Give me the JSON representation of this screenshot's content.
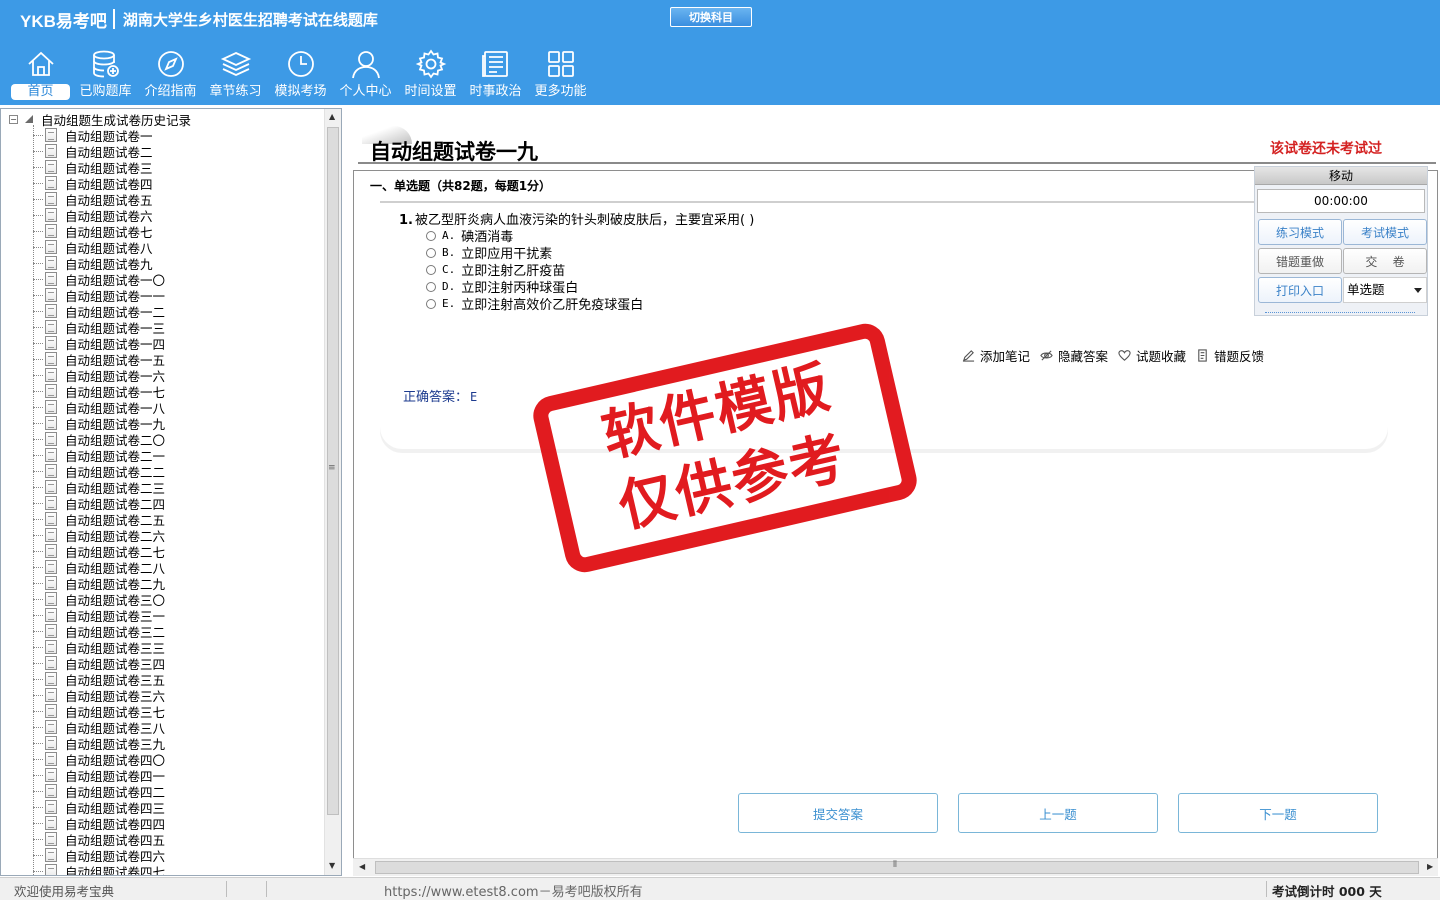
{
  "header": {
    "logo": "YKB易考吧",
    "app_title": "湖南大学生乡村医生招聘考试在线题库",
    "switch_subject": "切换科目",
    "nav": [
      {
        "label": "首页",
        "icon": "home-icon"
      },
      {
        "label": "已购题库",
        "icon": "database-icon"
      },
      {
        "label": "介绍指南",
        "icon": "compass-icon"
      },
      {
        "label": "章节练习",
        "icon": "layers-icon"
      },
      {
        "label": "模拟考场",
        "icon": "clock-icon"
      },
      {
        "label": "个人中心",
        "icon": "user-icon"
      },
      {
        "label": "时间设置",
        "icon": "gear-icon"
      },
      {
        "label": "时事政治",
        "icon": "news-icon"
      },
      {
        "label": "更多功能",
        "icon": "grid-icon"
      }
    ]
  },
  "tree": {
    "root": "自动组题生成试卷历史记录",
    "items": [
      "自动组题试卷一",
      "自动组题试卷二",
      "自动组题试卷三",
      "自动组题试卷四",
      "自动组题试卷五",
      "自动组题试卷六",
      "自动组题试卷七",
      "自动组题试卷八",
      "自动组题试卷九",
      "自动组题试卷一〇",
      "自动组题试卷一一",
      "自动组题试卷一二",
      "自动组题试卷一三",
      "自动组题试卷一四",
      "自动组题试卷一五",
      "自动组题试卷一六",
      "自动组题试卷一七",
      "自动组题试卷一八",
      "自动组题试卷一九",
      "自动组题试卷二〇",
      "自动组题试卷二一",
      "自动组题试卷二二",
      "自动组题试卷二三",
      "自动组题试卷二四",
      "自动组题试卷二五",
      "自动组题试卷二六",
      "自动组题试卷二七",
      "自动组题试卷二八",
      "自动组题试卷二九",
      "自动组题试卷三〇",
      "自动组题试卷三一",
      "自动组题试卷三二",
      "自动组题试卷三三",
      "自动组题试卷三四",
      "自动组题试卷三五",
      "自动组题试卷三六",
      "自动组题试卷三七",
      "自动组题试卷三八",
      "自动组题试卷三九",
      "自动组题试卷四〇",
      "自动组题试卷四一",
      "自动组题试卷四二",
      "自动组题试卷四三",
      "自动组题试卷四四",
      "自动组题试卷四五",
      "自动组题试卷四六",
      "自动组题试卷四七"
    ]
  },
  "main": {
    "paper_title": "自动组题试卷一九",
    "exam_status": "该试卷还未考试过",
    "section": "一、单选题（共82题，每题1分）",
    "question": {
      "number": "1.",
      "text": "被乙型肝炎病人血液污染的针头刺破皮肤后，主要宜采用( )",
      "options": [
        {
          "letter": "A.",
          "text": "碘酒消毒"
        },
        {
          "letter": "B.",
          "text": "立即应用干扰素"
        },
        {
          "letter": "C.",
          "text": "立即注射乙肝疫苗"
        },
        {
          "letter": "D.",
          "text": "立即注射丙种球蛋白"
        },
        {
          "letter": "E.",
          "text": "立即注射高效价乙肝免疫球蛋白"
        }
      ]
    },
    "actions": {
      "note": "添加笔记",
      "hide_answer": "隐藏答案",
      "favorite": "试题收藏",
      "feedback": "错题反馈"
    },
    "answer_label": "正确答案：",
    "answer_value": "E",
    "buttons": {
      "submit": "提交答案",
      "prev": "上一题",
      "next": "下一题"
    }
  },
  "control_panel": {
    "title": "移动",
    "timer": "00:00:00",
    "practice_mode": "练习模式",
    "exam_mode": "考试模式",
    "redo_wrong": "错题重做",
    "hand_in": "交    卷",
    "print": "打印入口",
    "question_type": "单选题"
  },
  "stamp": {
    "line1": "软件模版",
    "line2": "仅供参考"
  },
  "statusbar": {
    "welcome": "欢迎使用易考宝典",
    "copyright": "https://www.etest8.com－易考吧版权所有",
    "countdown": "考试倒计时 000 天"
  },
  "colors": {
    "header_bg": "#3d9ae6",
    "status_red": "#d42222",
    "answer_blue": "#1d3b8f",
    "stamp_red": "#e00f14"
  }
}
